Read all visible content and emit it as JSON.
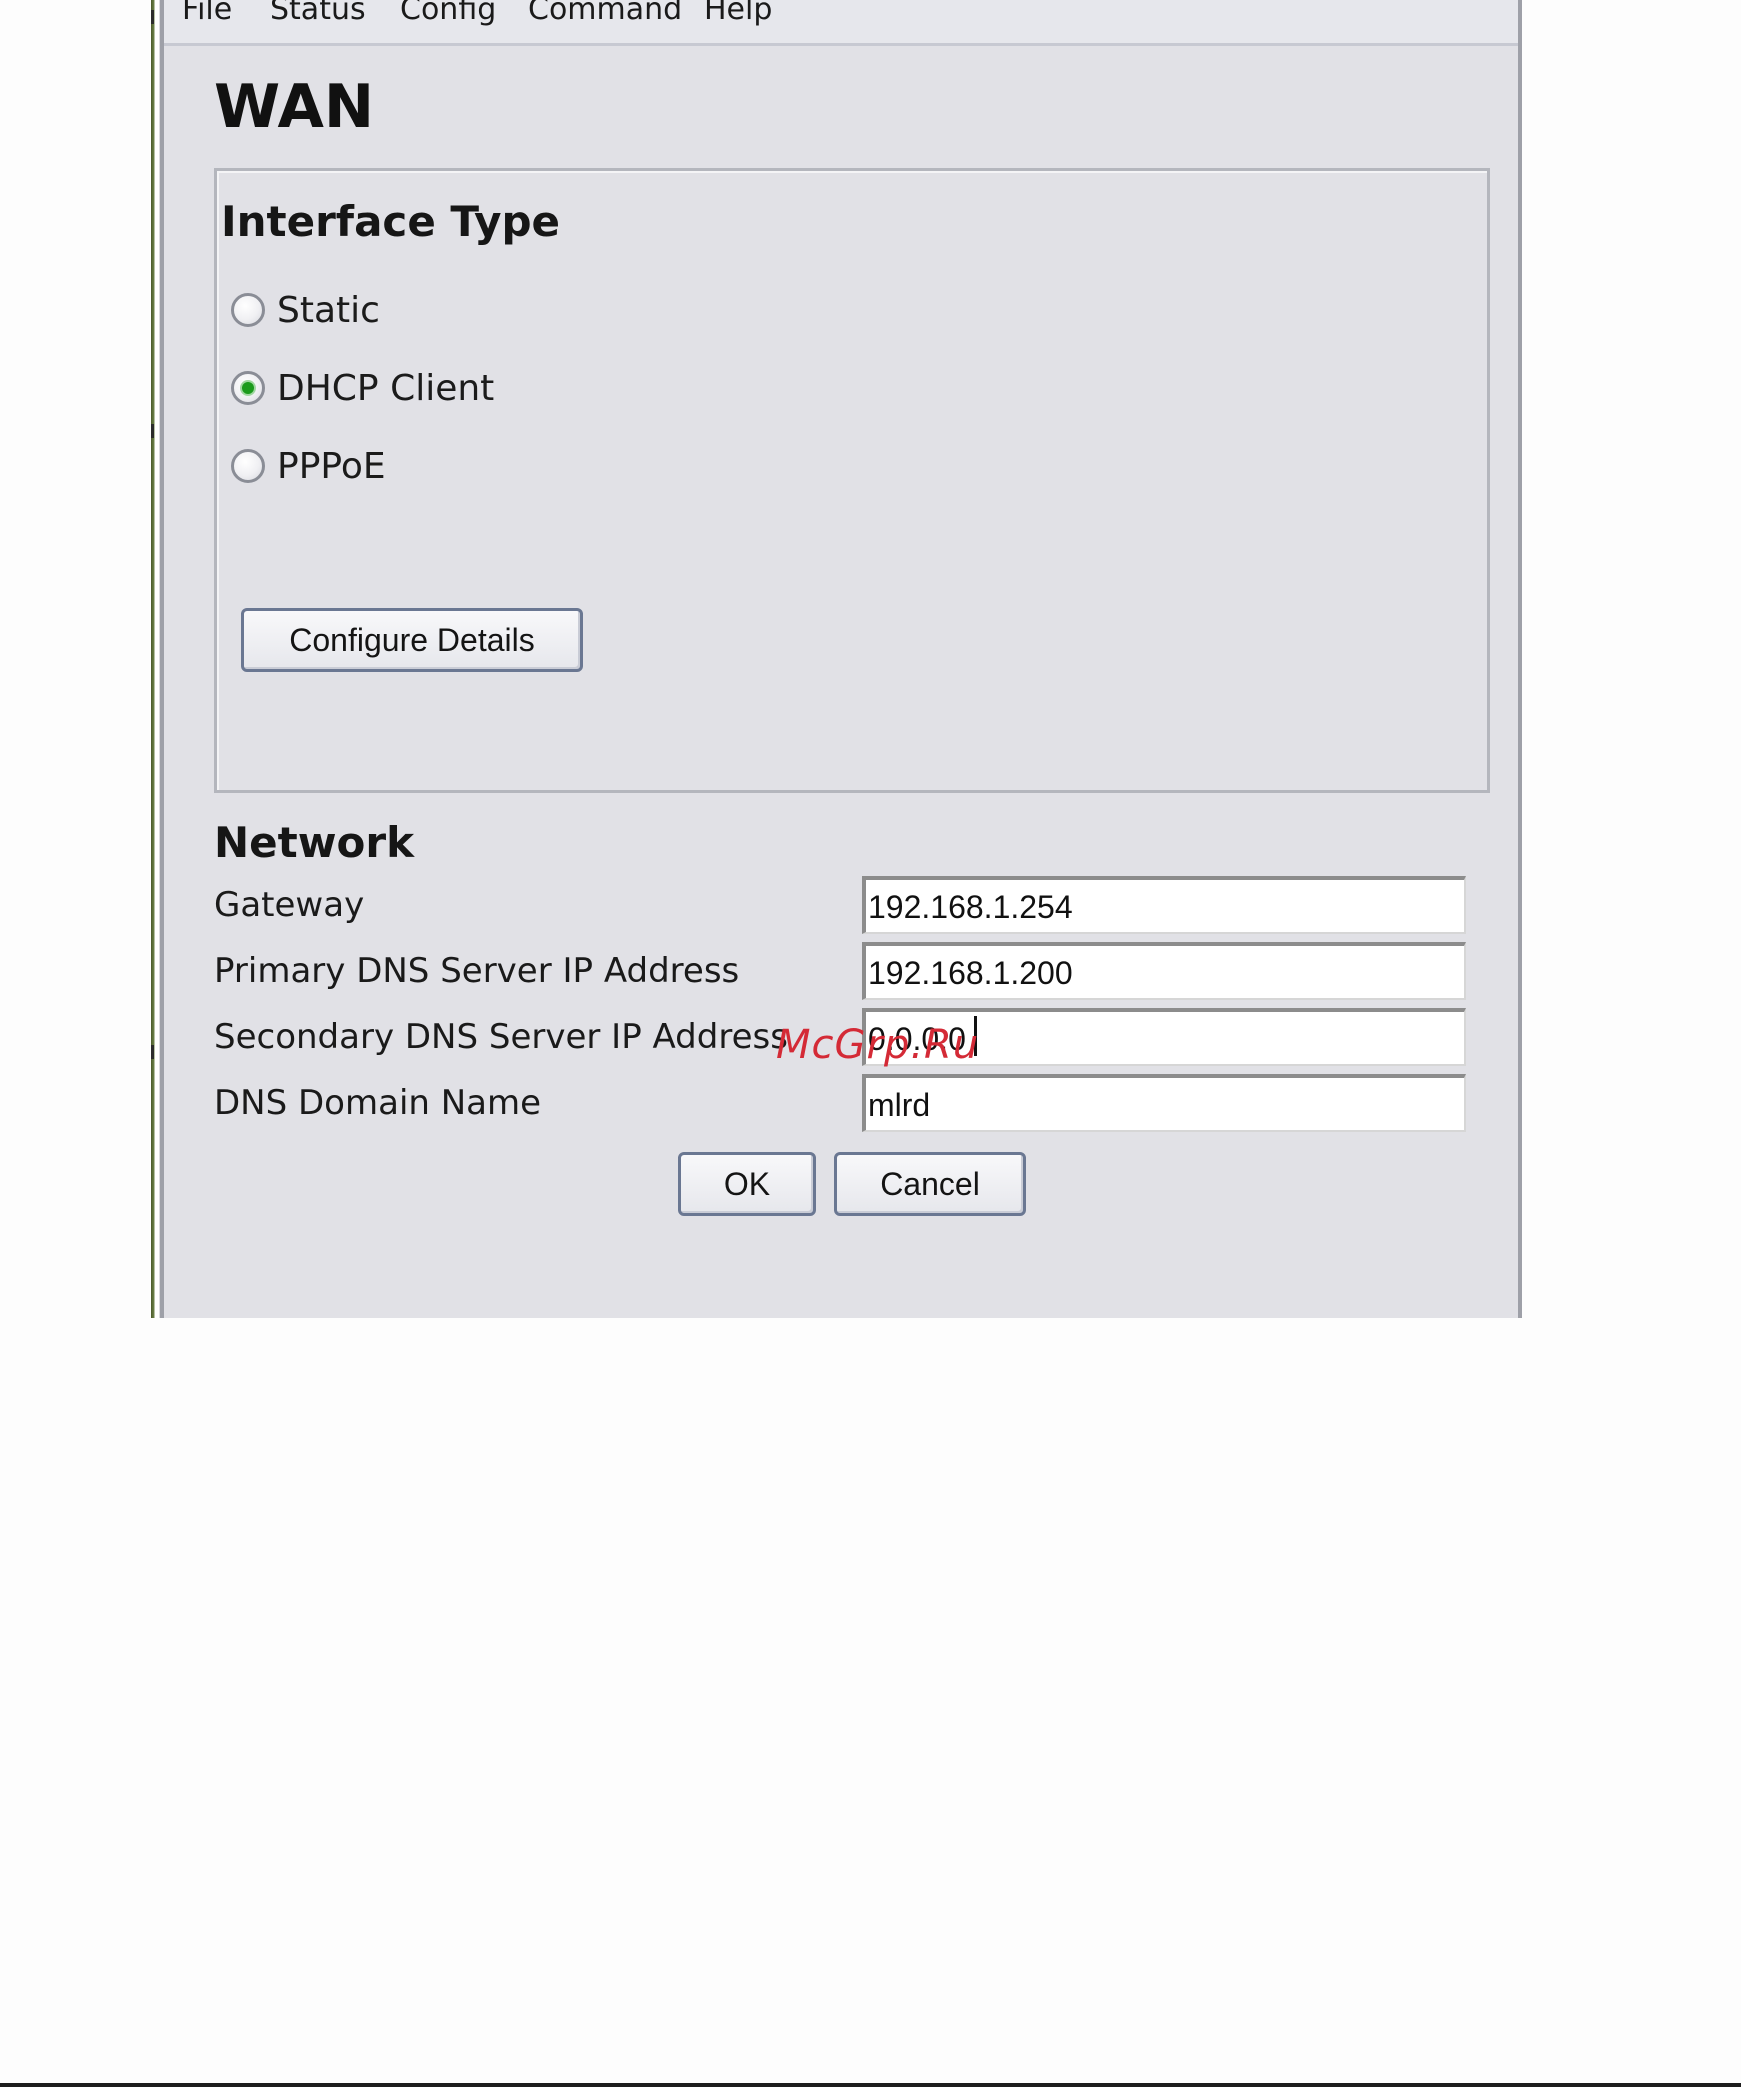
{
  "menubar": {
    "items": [
      "File",
      "Status",
      "Config",
      "Command",
      "Help"
    ]
  },
  "page": {
    "title": "WAN"
  },
  "interface_type": {
    "heading": "Interface Type",
    "options": [
      {
        "label": "Static",
        "checked": false
      },
      {
        "label": "DHCP Client",
        "checked": true
      },
      {
        "label": "PPPoE",
        "checked": false
      }
    ],
    "configure_button": "Configure Details"
  },
  "network": {
    "heading": "Network",
    "fields": [
      {
        "label": "Gateway",
        "value": "192.168.1.254"
      },
      {
        "label": "Primary DNS Server IP Address",
        "value": "192.168.1.200"
      },
      {
        "label": "Secondary DNS Server IP Address",
        "value": "0.0.0.0"
      },
      {
        "label": "DNS Domain Name",
        "value": "mlrd"
      }
    ]
  },
  "actions": {
    "ok": "OK",
    "cancel": "Cancel"
  },
  "watermark": "McGrp.Ru",
  "colors": {
    "window_bg": "#e1e1e6",
    "radio_selected": "#1c9b1c",
    "button_border": "#6a7792",
    "watermark": "#d42a36"
  }
}
